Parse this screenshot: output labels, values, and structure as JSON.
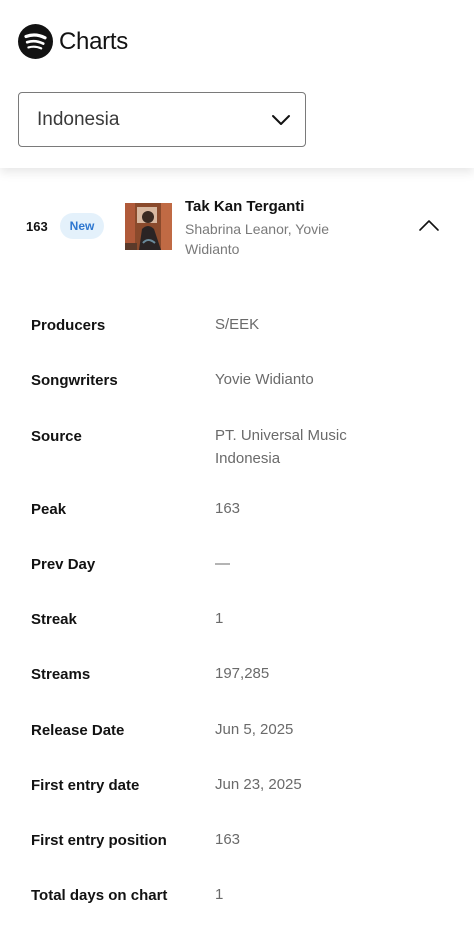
{
  "header": {
    "brand_name": "Charts",
    "logo_icon": "spotify-logo-icon"
  },
  "country_select": {
    "value": "Indonesia",
    "icon": "chevron-down-icon"
  },
  "track": {
    "rank": "163",
    "badge": "New",
    "title": "Tak Kan Terganti",
    "artist": "Shabrina Leanor, Yovie Widianto",
    "expand_icon": "chevron-up-icon"
  },
  "details": {
    "producers": {
      "label": "Producers",
      "value": "S/EEK"
    },
    "songwriters": {
      "label": "Songwriters",
      "value": "Yovie Widianto"
    },
    "source": {
      "label": "Source",
      "value": "PT. Universal Music Indonesia"
    },
    "peak": {
      "label": "Peak",
      "value": "163"
    },
    "prev_day": {
      "label": "Prev Day",
      "value": "—"
    },
    "streak": {
      "label": "Streak",
      "value": "1"
    },
    "streams": {
      "label": "Streams",
      "value": "197,285"
    },
    "release_date": {
      "label": "Release Date",
      "value": "Jun 5, 2025"
    },
    "first_entry_date": {
      "label": "First entry date",
      "value": "Jun 23, 2025"
    },
    "first_entry_position": {
      "label": "First entry position",
      "value": "163"
    },
    "total_days": {
      "label": "Total days on chart",
      "value": "1"
    }
  },
  "colors": {
    "badge_bg": "#e4f1fb",
    "badge_text": "#2e77d0",
    "muted_text": "#6a6a6a"
  }
}
